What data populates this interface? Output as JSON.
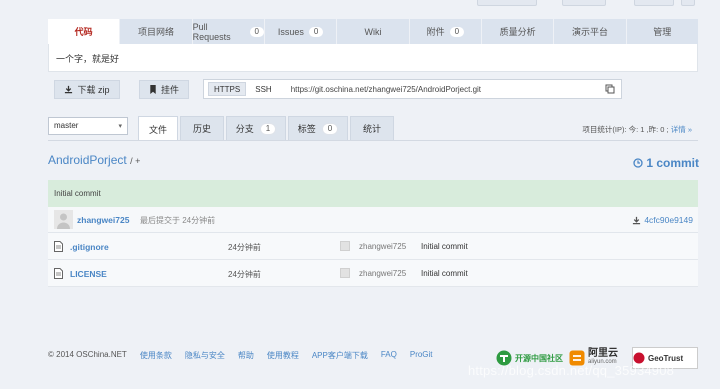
{
  "tabs": [
    {
      "label": "代码",
      "active": true
    },
    {
      "label": "项目网络"
    },
    {
      "label": "Pull Requests",
      "count": "0"
    },
    {
      "label": "Issues",
      "count": "0"
    },
    {
      "label": "Wiki"
    },
    {
      "label": "附件",
      "count": "0"
    },
    {
      "label": "质量分析"
    },
    {
      "label": "演示平台"
    },
    {
      "label": "管理"
    }
  ],
  "description": "一个字，就是好",
  "actions": {
    "download": "下载 zip",
    "widget": "挂件"
  },
  "clone": {
    "https": "HTTPS",
    "ssh": "SSH",
    "url": "https://git.oschina.net/zhangwei725/AndroidPorject.git"
  },
  "branch": {
    "selected": "master"
  },
  "subtabs": [
    {
      "label": "文件",
      "active": true
    },
    {
      "label": "历史"
    },
    {
      "label": "分支",
      "count": "1"
    },
    {
      "label": "标签",
      "count": "0"
    },
    {
      "label": "统计"
    }
  ],
  "stats": {
    "text": "项目统计(IP): 今: 1 ,昨: 0 ;",
    "link": "详情 »"
  },
  "repo": {
    "name": "AndroidPorject",
    "separator": "/ +",
    "commits": "1 commit"
  },
  "last_commit": {
    "message": "Initial commit",
    "author": "zhangwei725",
    "time": "最后提交于 24分钟前",
    "hash": "4cfc90e9149"
  },
  "files": [
    {
      "name": ".gitignore",
      "time": "24分钟前",
      "user": "zhangwei725",
      "message": "Initial commit"
    },
    {
      "name": "LICENSE",
      "time": "24分钟前",
      "user": "zhangwei725",
      "message": "Initial commit"
    }
  ],
  "footer": {
    "copyright": "© 2014 OSChina.NET",
    "links": [
      "使用条款",
      "隐私与安全",
      "帮助",
      "使用教程",
      "APP客户端下载",
      "FAQ",
      "ProGit"
    ]
  },
  "logos": {
    "oschina": "开源中国社区",
    "aliyun": "阿里云",
    "aliyun_sub": "aliyun.com",
    "geotrust": "GeoTrust"
  },
  "watermark": "https://blog.csdn.net/qq_35934908",
  "colors": {
    "accent": "#4a86c5",
    "active_tab": "#b3261e",
    "commit_bg": "#d8ecdc"
  }
}
